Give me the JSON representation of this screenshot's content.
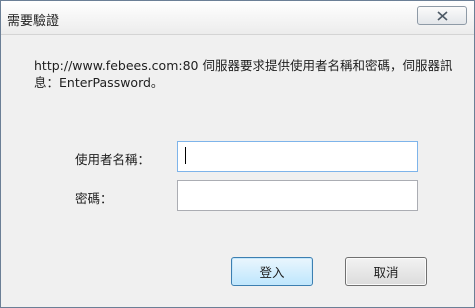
{
  "window": {
    "title": "需要驗證"
  },
  "message": "http://www.febees.com:80 伺服器要求提供使用者名稱和密碼，伺服器訊息：EnterPassword。",
  "form": {
    "username_label": "使用者名稱：",
    "username_value": "",
    "password_label": "密碼：",
    "password_value": ""
  },
  "buttons": {
    "login": "登入",
    "cancel": "取消"
  },
  "icons": {
    "close": "close-icon"
  },
  "colors": {
    "login_border": "#3c7fb1",
    "window_border": "#6b7f96"
  }
}
